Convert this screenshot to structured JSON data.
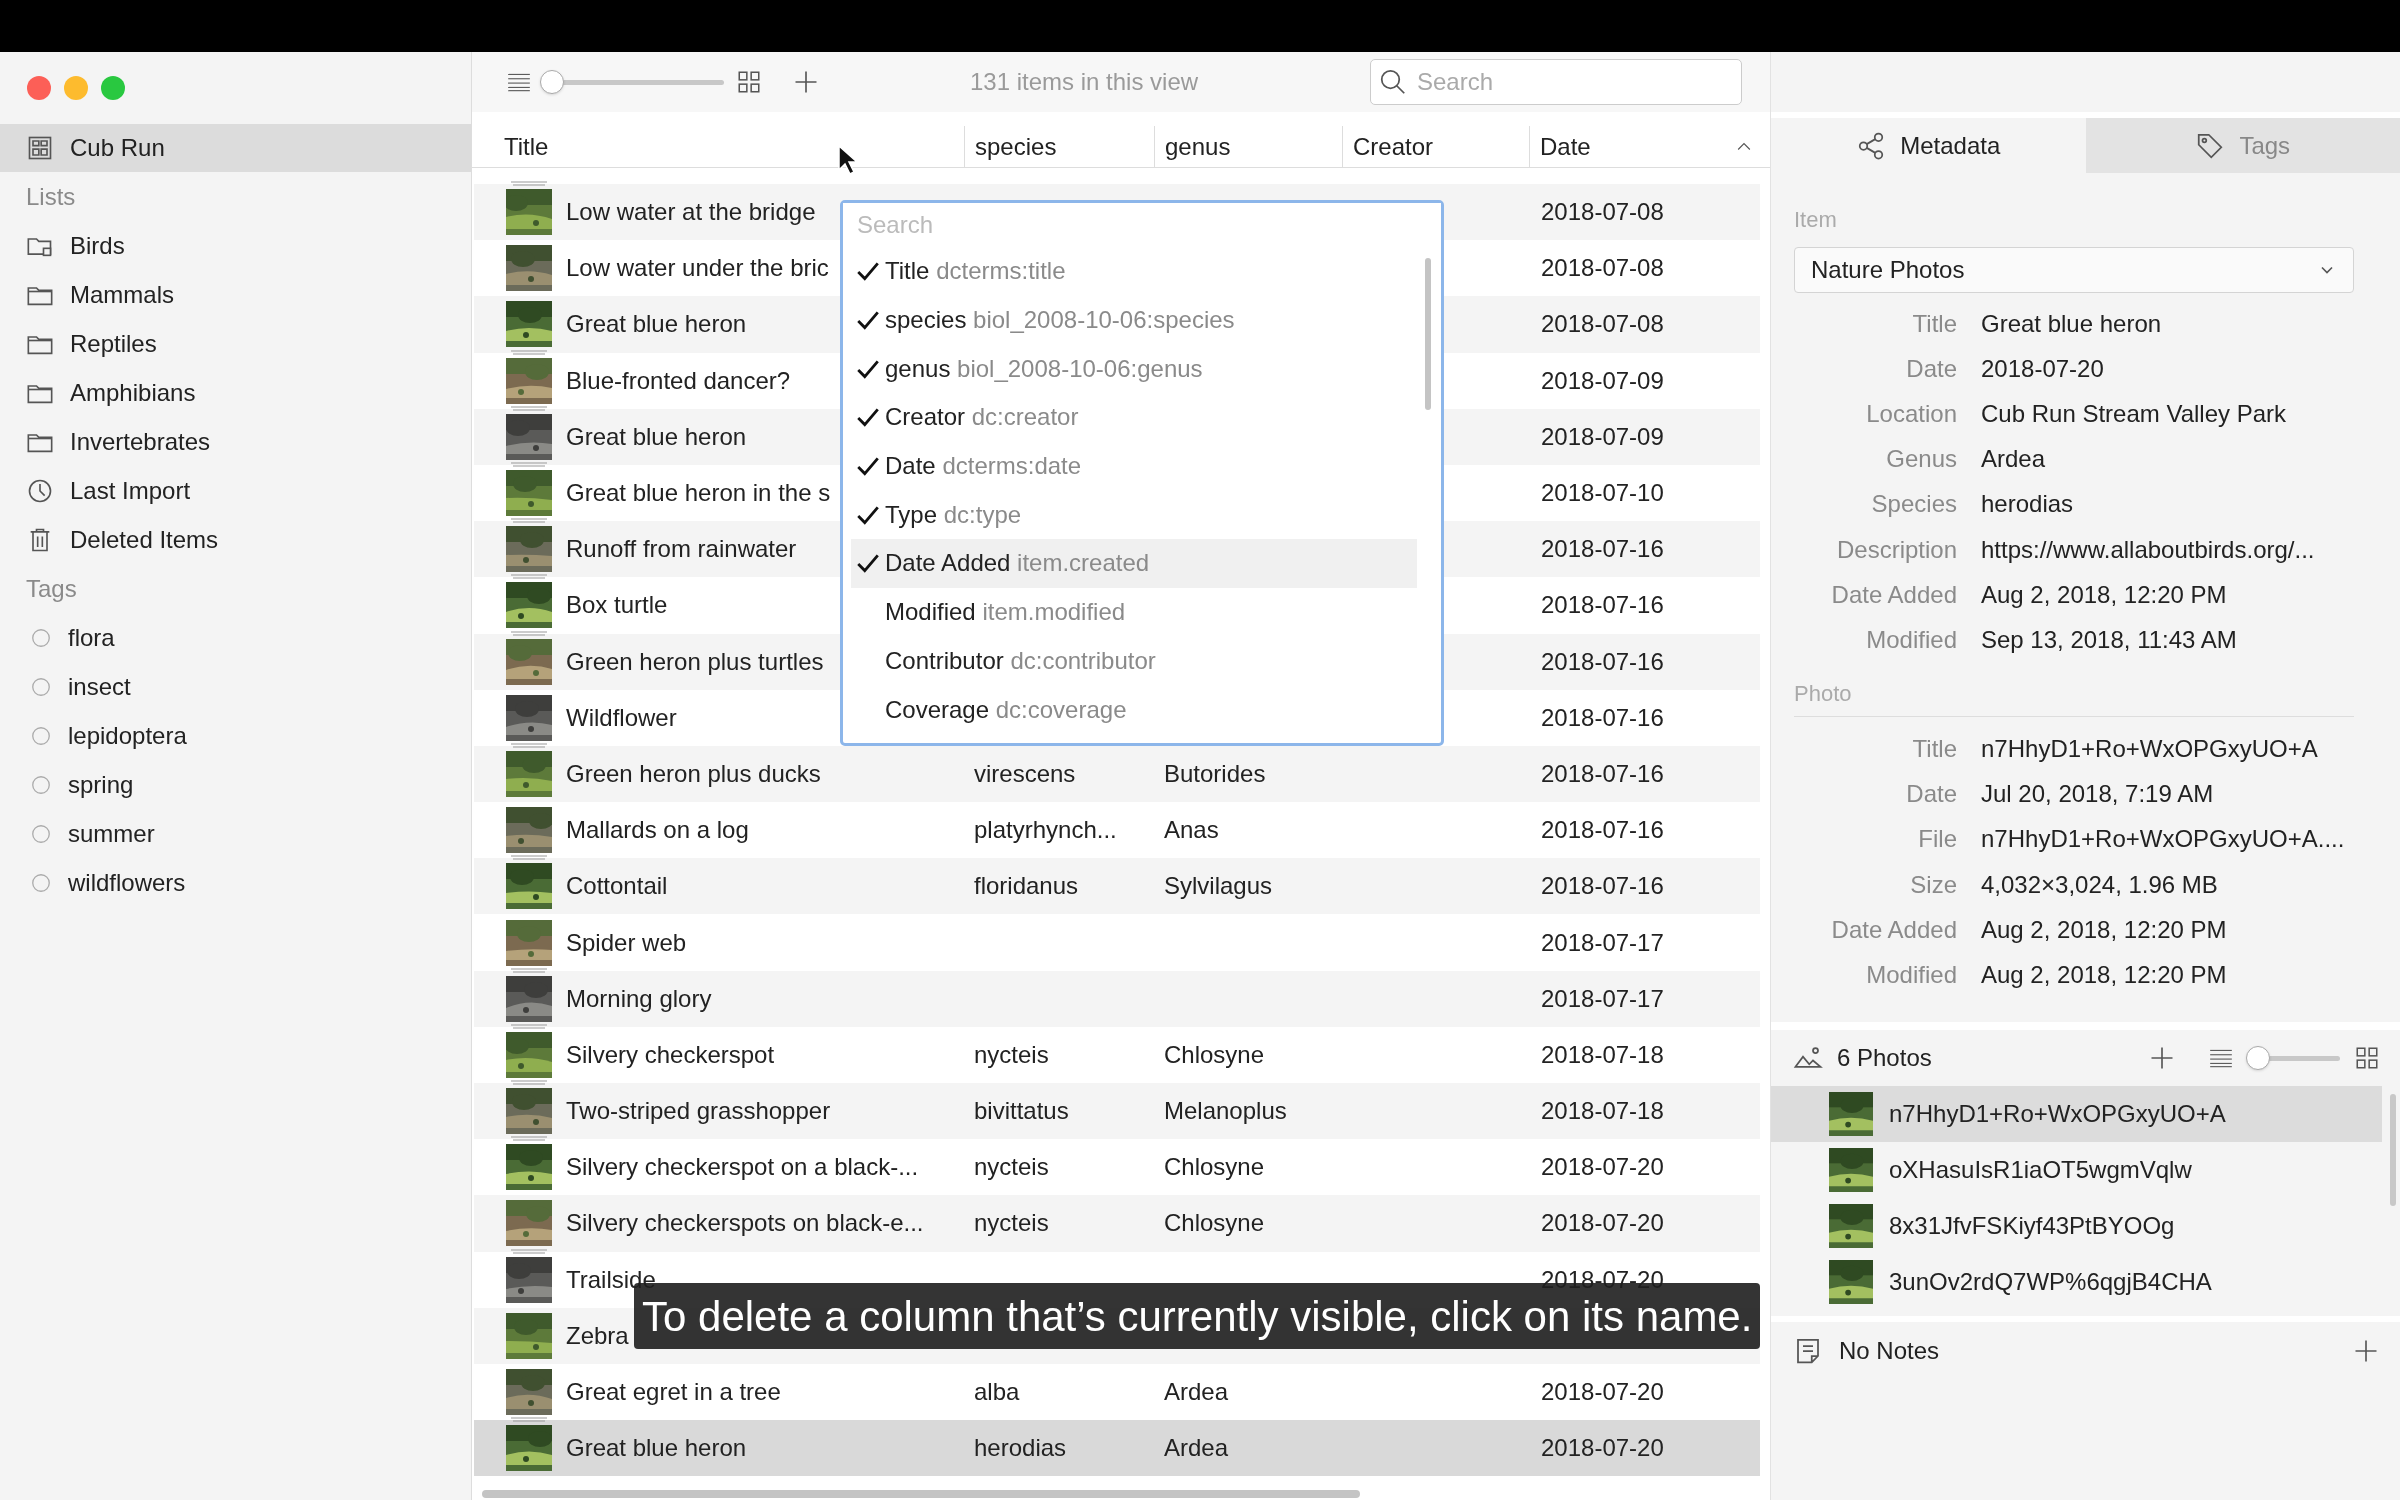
{
  "sidebar": {
    "project": {
      "label": "Cub Run",
      "selected": true
    },
    "lists_heading": "Lists",
    "lists": [
      {
        "label": "Birds",
        "kind": "subfolder",
        "selected": false
      },
      {
        "label": "Mammals",
        "kind": "folder",
        "selected": false
      },
      {
        "label": "Reptiles",
        "kind": "folder",
        "selected": false
      },
      {
        "label": "Amphibians",
        "kind": "folder",
        "selected": false
      },
      {
        "label": "Invertebrates",
        "kind": "folder",
        "selected": false
      },
      {
        "label": "Last Import",
        "kind": "clock",
        "selected": false
      },
      {
        "label": "Deleted Items",
        "kind": "trash",
        "selected": false
      }
    ],
    "tags_heading": "Tags",
    "tags": [
      {
        "label": "flora"
      },
      {
        "label": "insect"
      },
      {
        "label": "lepidoptera"
      },
      {
        "label": "spring"
      },
      {
        "label": "summer"
      },
      {
        "label": "wildflowers"
      }
    ]
  },
  "toolbar": {
    "zoom_slider": {
      "level": 0
    },
    "item_count": "131 items in this view",
    "search": {
      "placeholder": "Search"
    }
  },
  "table": {
    "columns": [
      {
        "label": "Title",
        "sorted": false
      },
      {
        "label": "species",
        "sorted": false
      },
      {
        "label": "genus",
        "sorted": false
      },
      {
        "label": "Creator",
        "sorted": false
      },
      {
        "label": "Date",
        "sorted": true
      }
    ],
    "rows": [
      {
        "title": "Low water at the bridge",
        "date": "2018-07-08",
        "stack": true,
        "selected": false
      },
      {
        "title": "Low water under the bric",
        "date": "2018-07-08",
        "stack": false,
        "selected": false
      },
      {
        "title": "Great blue heron",
        "date": "2018-07-08",
        "stack": false,
        "selected": false
      },
      {
        "title": "Blue-fronted dancer?",
        "date": "2018-07-09",
        "stack": true,
        "selected": false
      },
      {
        "title": "Great blue heron",
        "date": "2018-07-09",
        "stack": true,
        "selected": false
      },
      {
        "title": "Great blue heron in the s",
        "date": "2018-07-10",
        "stack": true,
        "selected": false
      },
      {
        "title": "Runoff from rainwater",
        "date": "2018-07-16",
        "stack": true,
        "selected": false
      },
      {
        "title": "Box turtle",
        "date": "2018-07-16",
        "stack": true,
        "selected": false
      },
      {
        "title": "Green heron plus turtles",
        "date": "2018-07-16",
        "stack": true,
        "selected": false
      },
      {
        "title": "Wildflower",
        "date": "2018-07-16",
        "stack": false,
        "selected": false
      },
      {
        "title": "Green heron plus ducks",
        "species": "virescens",
        "genus": "Butorides",
        "date": "2018-07-16",
        "stack": true,
        "selected": false
      },
      {
        "title": "Mallards on a log",
        "species": "platyrhynch...",
        "genus": "Anas",
        "date": "2018-07-16",
        "stack": false,
        "selected": false
      },
      {
        "title": "Cottontail",
        "species": "floridanus",
        "genus": "Sylvilagus",
        "date": "2018-07-16",
        "stack": true,
        "selected": false
      },
      {
        "title": "Spider web",
        "date": "2018-07-17",
        "stack": false,
        "selected": false
      },
      {
        "title": "Morning glory",
        "date": "2018-07-17",
        "stack": true,
        "selected": false
      },
      {
        "title": "Silvery checkerspot",
        "species": "nycteis",
        "genus": "Chlosyne",
        "date": "2018-07-18",
        "stack": true,
        "selected": false
      },
      {
        "title": "Two-striped grasshopper",
        "species": "bivittatus",
        "genus": "Melanoplus",
        "date": "2018-07-18",
        "stack": true,
        "selected": false
      },
      {
        "title": "Silvery checkerspot on a black-...",
        "species": "nycteis",
        "genus": "Chlosyne",
        "date": "2018-07-20",
        "stack": true,
        "selected": false
      },
      {
        "title": "Silvery checkerspots on black-e...",
        "species": "nycteis",
        "genus": "Chlosyne",
        "date": "2018-07-20",
        "stack": false,
        "selected": false
      },
      {
        "title": "Trailside",
        "date": "2018-07-20",
        "stack": true,
        "selected": false
      },
      {
        "title": "Zebra",
        "stack": false,
        "selected": false
      },
      {
        "title": "Great egret in a tree",
        "species": "alba",
        "genus": "Ardea",
        "date": "2018-07-20",
        "stack": false,
        "selected": false
      },
      {
        "title": "Great blue heron",
        "species": "herodias",
        "genus": "Ardea",
        "date": "2018-07-20",
        "stack": true,
        "selected": true
      }
    ]
  },
  "column_menu": {
    "search": {
      "placeholder": "Search"
    },
    "items": [
      {
        "label": "Title",
        "property": "dcterms:title",
        "checked": true,
        "selected": false
      },
      {
        "label": "species",
        "property": "biol_2008-10-06:species",
        "checked": true,
        "selected": false
      },
      {
        "label": "genus",
        "property": "biol_2008-10-06:genus",
        "checked": true,
        "selected": false
      },
      {
        "label": "Creator",
        "property": "dc:creator",
        "checked": true,
        "selected": false
      },
      {
        "label": "Date",
        "property": "dcterms:date",
        "checked": true,
        "selected": false
      },
      {
        "label": "Type",
        "property": "dc:type",
        "checked": true,
        "selected": false
      },
      {
        "label": "Date Added",
        "property": "item.created",
        "checked": true,
        "selected": true
      },
      {
        "label": "Modified",
        "property": "item.modified",
        "checked": false,
        "selected": false
      },
      {
        "label": "Contributor",
        "property": "dc:contributor",
        "checked": false,
        "selected": false
      },
      {
        "label": "Coverage",
        "property": "dc:coverage",
        "checked": false,
        "selected": false
      }
    ]
  },
  "inspector": {
    "tabs": [
      {
        "label": "Metadata",
        "kind": "share",
        "selected": true
      },
      {
        "label": "Tags",
        "kind": "tag",
        "selected": false
      }
    ],
    "item_heading": "Item",
    "template": "Nature Photos",
    "item_fields": [
      {
        "label": "Title",
        "value": "Great blue heron"
      },
      {
        "label": "Date",
        "value": "2018-07-20"
      },
      {
        "label": "Location",
        "value": "Cub Run Stream Valley Park"
      },
      {
        "label": "Genus",
        "value": "Ardea"
      },
      {
        "label": "Species",
        "value": "herodias"
      },
      {
        "label": "Description",
        "value": "https://www.allaboutbirds.org/..."
      },
      {
        "label": "Date Added",
        "value": "Aug 2, 2018, 12:20 PM"
      },
      {
        "label": "Modified",
        "value": "Sep 13, 2018, 11:43 AM"
      }
    ],
    "photo_heading": "Photo",
    "photo_fields": [
      {
        "label": "Title",
        "value": "n7HhyD1+Ro+WxOPGxyUO+A"
      },
      {
        "label": "Date",
        "value": "Jul 20, 2018, 7:19 AM"
      },
      {
        "label": "File",
        "value": "n7HhyD1+Ro+WxOPGxyUO+A...."
      },
      {
        "label": "Size",
        "value": "4,032×3,024, 1.96 MB"
      },
      {
        "label": "Date Added",
        "value": "Aug 2, 2018, 12:20 PM"
      },
      {
        "label": "Modified",
        "value": "Aug 2, 2018, 12:20 PM"
      }
    ],
    "photos": {
      "heading": "6 Photos",
      "size_slider": {
        "level": 0
      },
      "items": [
        {
          "name": "n7HhyD1+Ro+WxOPGxyUO+A",
          "selected": true
        },
        {
          "name": "oXHasuIsR1iaOT5wgmVqlw",
          "selected": false
        },
        {
          "name": "8x31JfvFSKiyf43PtBYOOg",
          "selected": false
        },
        {
          "name": "3unOv2rdQ7WP%6qgjB4CHA",
          "selected": false
        }
      ]
    },
    "notes": {
      "heading": "No Notes"
    }
  },
  "caption": "To delete a column that’s currently visible, click on its name."
}
